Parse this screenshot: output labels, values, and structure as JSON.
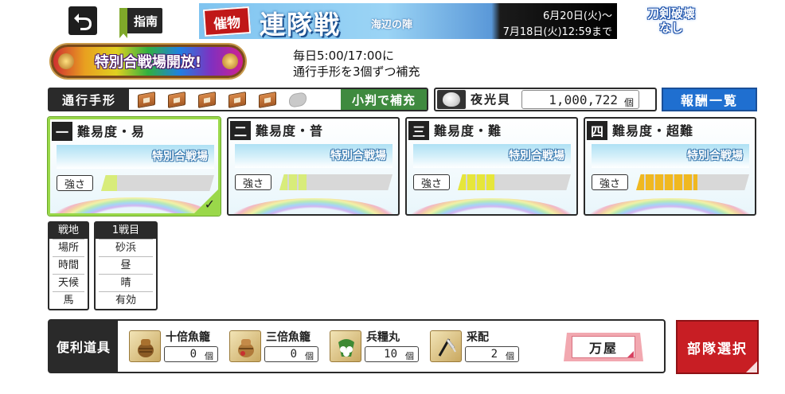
{
  "colors": {
    "accent_green": "#9ad84a",
    "refill_green": "#3f8a3f",
    "reward_blue": "#1f6fd0",
    "deploy_red": "#c81e24",
    "dark": "#2a2a2a"
  },
  "top": {
    "back_icon": "undo-arrow-icon",
    "guide_label": "指南",
    "no_break_line1": "刀剣破壊",
    "no_break_line2": "なし"
  },
  "banner": {
    "tag": "催物",
    "title": "連隊戦",
    "subtitle": "海辺の陣",
    "date_start": "6月20日(火)～",
    "date_end": "7月18日(火)12:59まで"
  },
  "special": {
    "badge": "特別合戦場開放!",
    "notice_line1": "毎日5:00/17:00に",
    "notice_line2": "通行手形を3個ずつ補充"
  },
  "pass": {
    "label": "通行手形",
    "tokens": [
      true,
      true,
      true,
      true,
      true,
      false
    ],
    "refill_label": "小判で補充"
  },
  "currency": {
    "icon": "seashell-icon",
    "label": "夜光貝",
    "value": "1,000,722",
    "unit": "個"
  },
  "reward_label": "報酬一覧",
  "difficulties": [
    {
      "num": "一",
      "label": "難易度・易",
      "banner": "特別合戦場",
      "strength_label": "強さ",
      "strength": 1,
      "selected": true
    },
    {
      "num": "二",
      "label": "難易度・普",
      "banner": "特別合戦場",
      "strength_label": "強さ",
      "strength": 2,
      "selected": false
    },
    {
      "num": "三",
      "label": "難易度・難",
      "banner": "特別合戦場",
      "strength_label": "強さ",
      "strength": 3,
      "selected": false
    },
    {
      "num": "四",
      "label": "難易度・超難",
      "banner": "特別合戦場",
      "strength_label": "強さ",
      "strength": 5,
      "selected": false
    }
  ],
  "selected_mark": "✓",
  "field_info": {
    "header_left": "戦地",
    "header_right": "1戦目",
    "rows": [
      {
        "label": "場所",
        "value": "砂浜"
      },
      {
        "label": "時間",
        "value": "昼"
      },
      {
        "label": "天候",
        "value": "晴"
      },
      {
        "label": "馬",
        "value": "有効"
      }
    ]
  },
  "items": {
    "label": "便利道具",
    "list": [
      {
        "name": "十倍魚籠",
        "count": "0",
        "unit": "個",
        "icon": "fish-basket-icon"
      },
      {
        "name": "三倍魚籠",
        "count": "0",
        "unit": "個",
        "icon": "fish-basket-icon"
      },
      {
        "name": "兵糧丸",
        "count": "10",
        "unit": "個",
        "icon": "ration-pill-icon"
      },
      {
        "name": "采配",
        "count": "2",
        "unit": "個",
        "icon": "command-baton-icon"
      }
    ]
  },
  "shop_label": "万屋",
  "deploy_label": "部隊選択"
}
